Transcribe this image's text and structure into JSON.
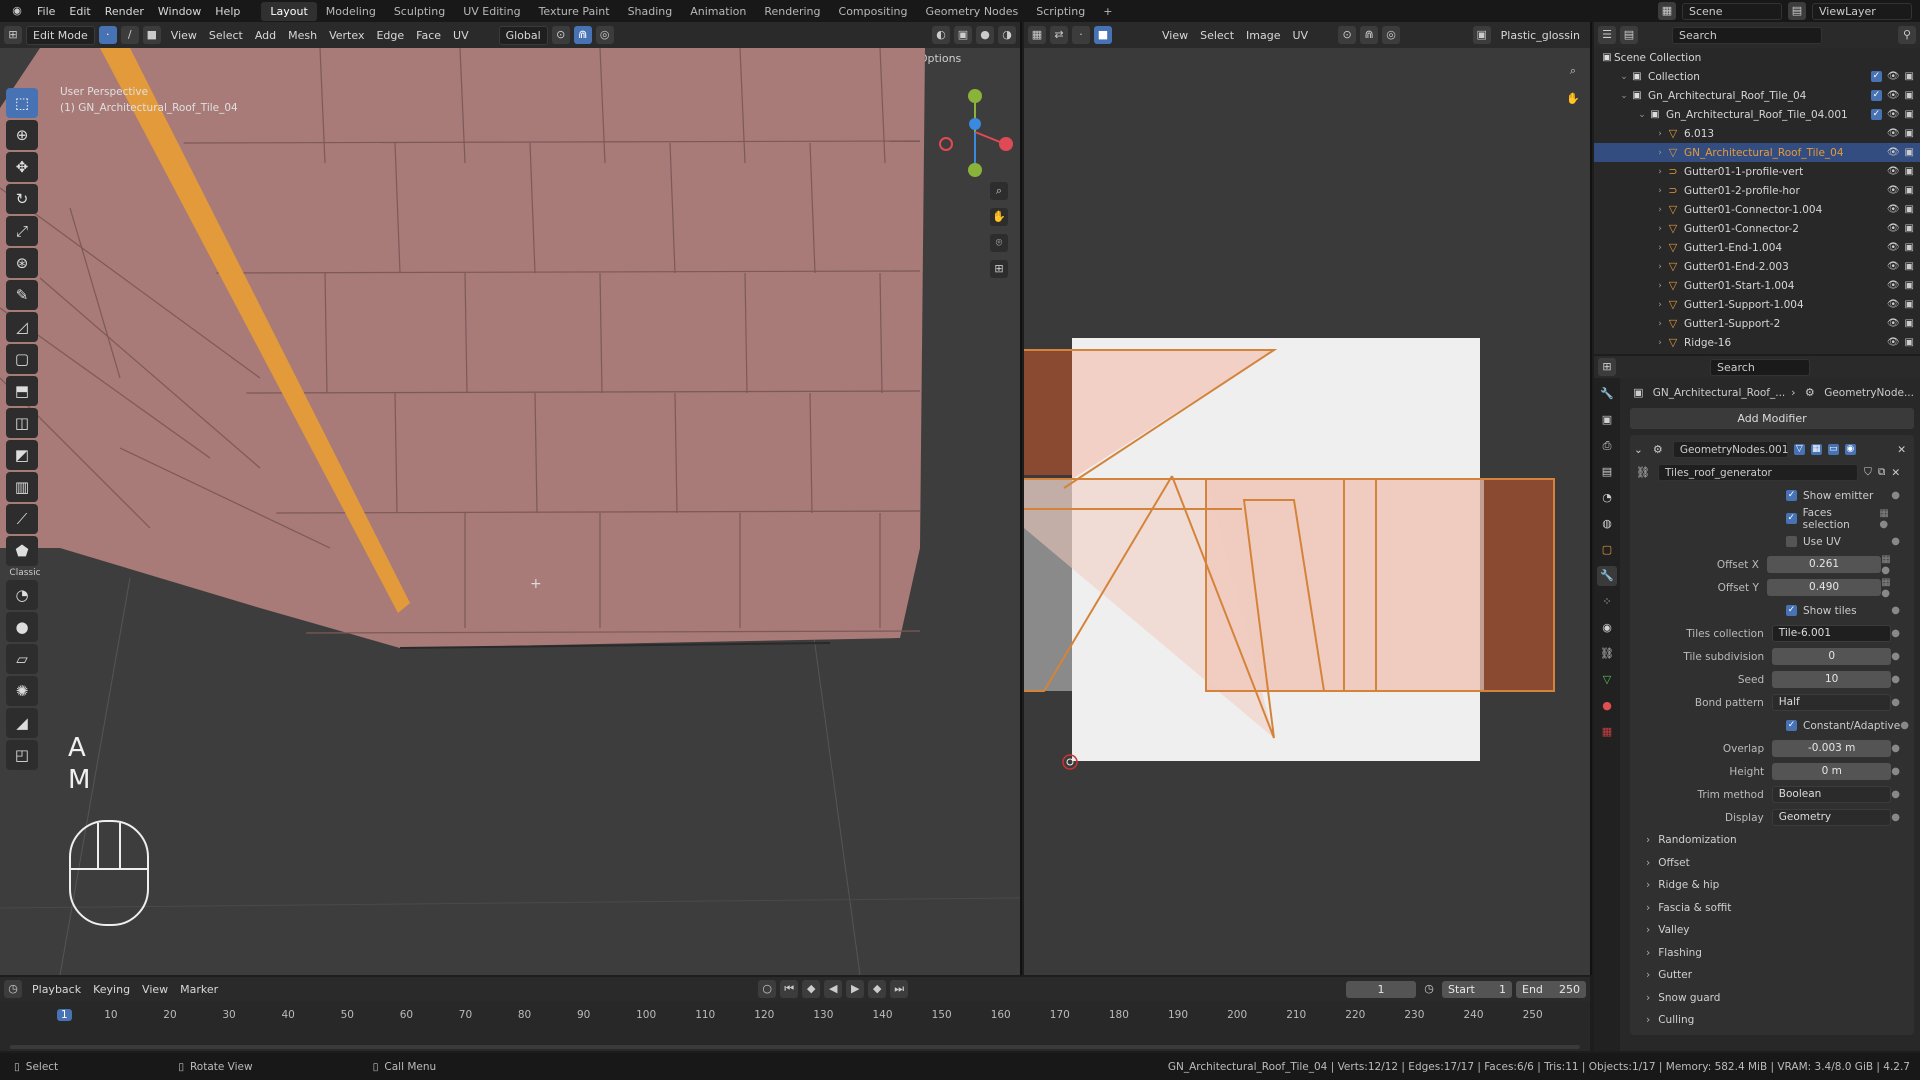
{
  "topbar": {
    "menus": [
      "File",
      "Edit",
      "Render",
      "Window",
      "Help"
    ],
    "workspaces": [
      "Layout",
      "Modeling",
      "Sculpting",
      "UV Editing",
      "Texture Paint",
      "Shading",
      "Animation",
      "Rendering",
      "Compositing",
      "Geometry Nodes",
      "Scripting",
      "+"
    ],
    "active_workspace": "Layout",
    "scene": "Scene",
    "view_layer": "ViewLayer"
  },
  "viewport": {
    "mode": "Edit Mode",
    "menus": [
      "View",
      "Select",
      "Add",
      "Mesh",
      "Vertex",
      "Edge",
      "Face",
      "UV"
    ],
    "orientation": "Global",
    "axis_labels": [
      "X",
      "Y",
      "Z"
    ],
    "options_label": "Options",
    "info_line1": "User Perspective",
    "info_line2": "(1) GN_Architectural_Roof_Tile_04",
    "key_a": "A",
    "key_m": "M",
    "classic_label": "Classic"
  },
  "uv_editor": {
    "menus": [
      "View",
      "Select",
      "Image",
      "UV"
    ],
    "image_name": "Plastic_glossin"
  },
  "outliner": {
    "search_placeholder": "Search",
    "root": "Scene Collection",
    "rows": [
      {
        "name": "Collection",
        "indent": 1,
        "type": "collection",
        "selected": false
      },
      {
        "name": "Gn_Architectural_Roof_Tile_04",
        "indent": 1,
        "type": "collection",
        "selected": false
      },
      {
        "name": "Gn_Architectural_Roof_Tile_04.001",
        "indent": 2,
        "type": "collection",
        "selected": false
      },
      {
        "name": "6.013",
        "indent": 3,
        "type": "mesh",
        "selected": false
      },
      {
        "name": "GN_Architectural_Roof_Tile_04",
        "indent": 3,
        "type": "mesh",
        "selected": true
      },
      {
        "name": "Gutter01-1-profile-vert",
        "indent": 3,
        "type": "curve",
        "selected": false
      },
      {
        "name": "Gutter01-2-profile-hor",
        "indent": 3,
        "type": "curve",
        "selected": false
      },
      {
        "name": "Gutter01-Connector-1.004",
        "indent": 3,
        "type": "mesh",
        "selected": false
      },
      {
        "name": "Gutter01-Connector-2",
        "indent": 3,
        "type": "mesh",
        "selected": false
      },
      {
        "name": "Gutter1-End-1.004",
        "indent": 3,
        "type": "mesh",
        "selected": false
      },
      {
        "name": "Gutter01-End-2.003",
        "indent": 3,
        "type": "mesh",
        "selected": false
      },
      {
        "name": "Gutter01-Start-1.004",
        "indent": 3,
        "type": "mesh",
        "selected": false
      },
      {
        "name": "Gutter1-Support-1.004",
        "indent": 3,
        "type": "mesh",
        "selected": false
      },
      {
        "name": "Gutter1-Support-2",
        "indent": 3,
        "type": "mesh",
        "selected": false
      },
      {
        "name": "Ridge-16",
        "indent": 3,
        "type": "mesh",
        "selected": false
      }
    ]
  },
  "properties": {
    "search_placeholder": "Search",
    "breadcrumb_object": "GN_Architectural_Roof_...",
    "breadcrumb_modifier": "GeometryNode...",
    "add_modifier": "Add Modifier",
    "modifier_name": "GeometryNodes.001",
    "node_group": "Tiles_roof_generator",
    "show_emitter": "Show emitter",
    "faces_selection": "Faces selection",
    "use_uv": "Use UV",
    "offset_x_label": "Offset X",
    "offset_x": "0.261",
    "offset_y_label": "Offset Y",
    "offset_y": "0.490",
    "show_tiles": "Show tiles",
    "tiles_collection_label": "Tiles collection",
    "tiles_collection": "Tile-6.001",
    "tile_subdivision_label": "Tile subdivision",
    "tile_subdivision": "0",
    "seed_label": "Seed",
    "seed": "10",
    "bond_pattern_label": "Bond pattern",
    "bond_pattern": "Half",
    "constant_adaptive": "Constant/Adaptive",
    "overlap_label": "Overlap",
    "overlap": "-0.003 m",
    "height_label": "Height",
    "height": "0 m",
    "trim_method_label": "Trim method",
    "trim_method": "Boolean",
    "display_label": "Display",
    "display": "Geometry",
    "sections": [
      "Randomization",
      "Offset",
      "Ridge & hip",
      "Fascia & soffit",
      "Valley",
      "Flashing",
      "Gutter",
      "Snow guard",
      "Culling"
    ]
  },
  "timeline": {
    "menus": [
      "Playback",
      "Keying",
      "View",
      "Marker"
    ],
    "current_frame": "1",
    "start_label": "Start",
    "start": "1",
    "end_label": "End",
    "end": "250",
    "ticks": [
      "1",
      "10",
      "20",
      "30",
      "40",
      "50",
      "60",
      "70",
      "80",
      "90",
      "100",
      "110",
      "120",
      "130",
      "140",
      "150",
      "160",
      "170",
      "180",
      "190",
      "200",
      "210",
      "220",
      "230",
      "240",
      "250"
    ]
  },
  "statusbar": {
    "select": "Select",
    "rotate": "Rotate View",
    "call_menu": "Call Menu",
    "stats": "GN_Architectural_Roof_Tile_04 | Verts:12/12 | Edges:17/17 | Faces:6/6 | Tris:11 | Objects:1/17 | Memory: 582.4 MiB | VRAM: 3.4/8.0 GiB | 4.2.7"
  },
  "colors": {
    "accent": "#4772b3",
    "edge_select": "#e39a3b",
    "tile": "#a87a78",
    "uv_face": "#f0c0b0"
  }
}
